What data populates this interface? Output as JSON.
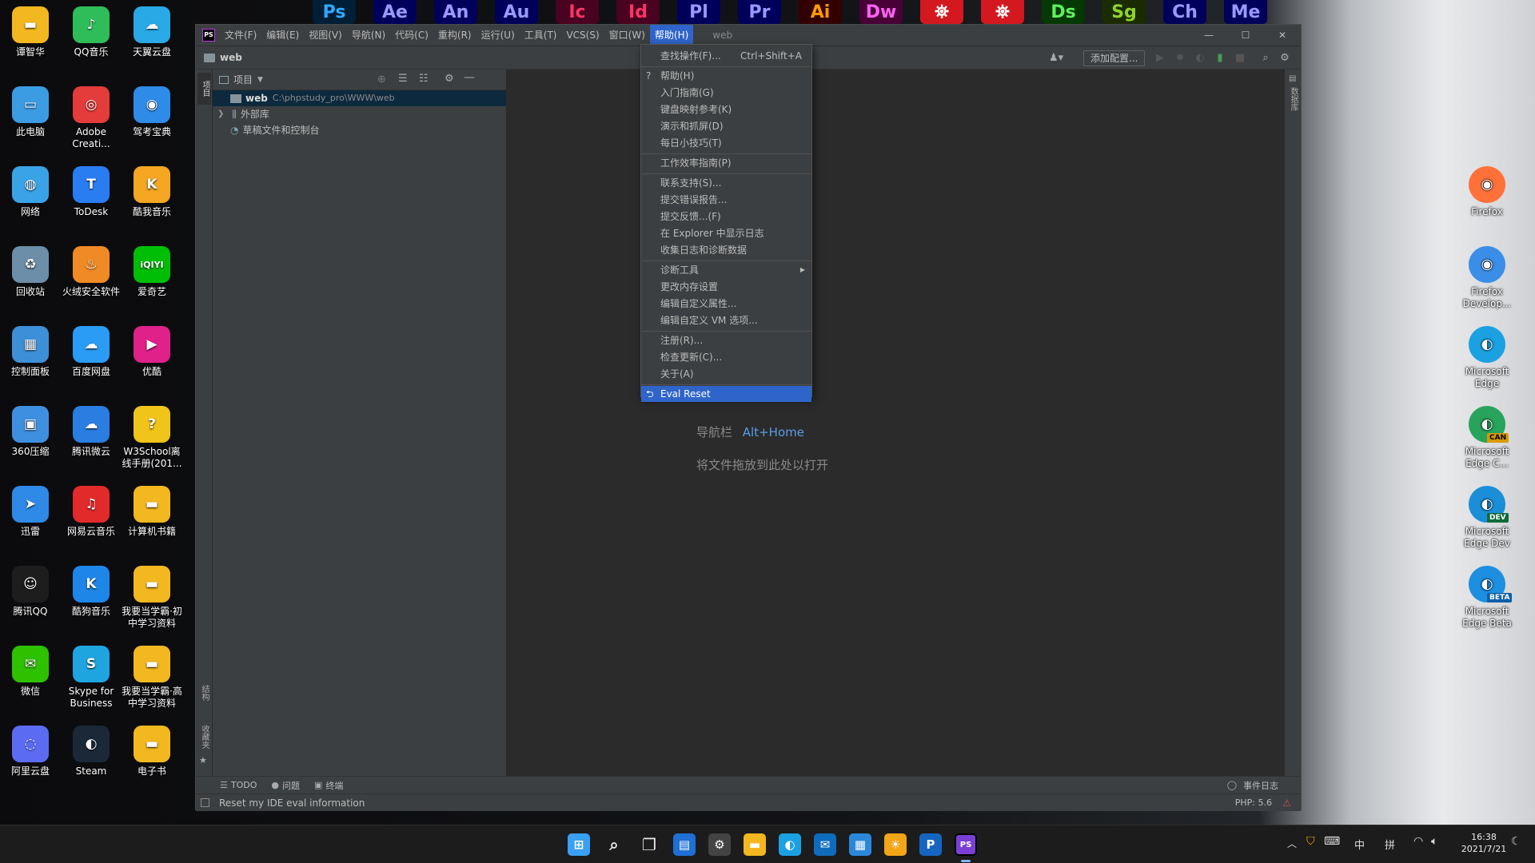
{
  "desktop": {
    "left_icons": [
      {
        "label": "谭智华",
        "glyph": "▬",
        "color": "#f3b81f"
      },
      {
        "label": "QQ音乐",
        "glyph": "♪",
        "color": "#2ebd59"
      },
      {
        "label": "天翼云盘",
        "glyph": "☁",
        "color": "#29a9e6"
      },
      {
        "label": "此电脑",
        "glyph": "▭",
        "color": "#3b9ce4"
      },
      {
        "label": "Adobe Creati...",
        "glyph": "◎",
        "color": "#e43b3b"
      },
      {
        "label": "驾考宝典",
        "glyph": "◉",
        "color": "#2f8be8"
      },
      {
        "label": "网络",
        "glyph": "◍",
        "color": "#3aa3e8"
      },
      {
        "label": "ToDesk",
        "glyph": "T",
        "color": "#2a7df0"
      },
      {
        "label": "酷我音乐",
        "glyph": "K",
        "color": "#f5a623"
      },
      {
        "label": "回收站",
        "glyph": "♻",
        "color": "#6c8ea8"
      },
      {
        "label": "火绒安全软件",
        "glyph": "♨",
        "color": "#f08a24"
      },
      {
        "label": "爱奇艺",
        "glyph": "iQIYI",
        "color": "#00be06"
      },
      {
        "label": "控制面板",
        "glyph": "▦",
        "color": "#3d8fd8"
      },
      {
        "label": "百度网盘",
        "glyph": "☁",
        "color": "#2b9cf5"
      },
      {
        "label": "优酷",
        "glyph": "▶",
        "color": "#e0218a"
      },
      {
        "label": "360压缩",
        "glyph": "▣",
        "color": "#3f8fe0"
      },
      {
        "label": "腾讯微云",
        "glyph": "☁",
        "color": "#2a7de1"
      },
      {
        "label": "W3School离线手册(201...",
        "glyph": "?",
        "color": "#f0c419"
      },
      {
        "label": "迅雷",
        "glyph": "➤",
        "color": "#2e8ae6"
      },
      {
        "label": "网易云音乐",
        "glyph": "♫",
        "color": "#e32a2a"
      },
      {
        "label": "计算机书籍",
        "glyph": "▬",
        "color": "#f3b81f"
      },
      {
        "label": "腾讯QQ",
        "glyph": "☺",
        "color": "#1d1d1d"
      },
      {
        "label": "酷狗音乐",
        "glyph": "K",
        "color": "#1f86e9"
      },
      {
        "label": "我要当学霸·初中学习资料",
        "glyph": "▬",
        "color": "#f3b81f"
      },
      {
        "label": "微信",
        "glyph": "✉",
        "color": "#2dc100"
      },
      {
        "label": "Skype for Business",
        "glyph": "S",
        "color": "#1ea5e0"
      },
      {
        "label": "我要当学霸·高中学习资料",
        "glyph": "▬",
        "color": "#f3b81f"
      },
      {
        "label": "阿里云盘",
        "glyph": "◌",
        "color": "#5b6cf2"
      },
      {
        "label": "Steam",
        "glyph": "◐",
        "color": "#1b2838"
      },
      {
        "label": "电子书",
        "glyph": "▬",
        "color": "#f3b81f"
      }
    ],
    "right_icons": [
      {
        "label": "Firefox",
        "glyph": "◉",
        "color": "#ff7139"
      },
      {
        "label": "Firefox Develop...",
        "glyph": "◉",
        "color": "#3a8ee8"
      },
      {
        "label": "Microsoft Edge",
        "glyph": "◐",
        "color": "#1ba1e2"
      },
      {
        "label": "Microsoft Edge C...",
        "glyph": "◐",
        "color": "#27a35b",
        "badge": "CAN"
      },
      {
        "label": "Microsoft Edge Dev",
        "glyph": "◐",
        "color": "#1b8ed8",
        "badge": "DEV"
      },
      {
        "label": "Microsoft Edge Beta",
        "glyph": "◐",
        "color": "#1d8fe0",
        "badge": "BETA"
      }
    ]
  },
  "dock": [
    {
      "label": "Ps",
      "bg": "#001e36",
      "fg": "#31a8ff"
    },
    {
      "label": "Ae",
      "bg": "#00005b",
      "fg": "#9999ff"
    },
    {
      "label": "An",
      "bg": "#00005b",
      "fg": "#9a9aff"
    },
    {
      "label": "Au",
      "bg": "#00005b",
      "fg": "#9999ff"
    },
    {
      "label": "Ic",
      "bg": "#49021f",
      "fg": "#ff3366"
    },
    {
      "label": "Id",
      "bg": "#49021f",
      "fg": "#ff3366"
    },
    {
      "label": "Pl",
      "bg": "#00005b",
      "fg": "#9999ff"
    },
    {
      "label": "Pr",
      "bg": "#00005b",
      "fg": "#9999ff"
    },
    {
      "label": "Ai",
      "bg": "#330000",
      "fg": "#ff9a00"
    },
    {
      "label": "Dw",
      "bg": "#470137",
      "fg": "#ff61f6"
    },
    {
      "label": "⛯",
      "bg": "#d4181f",
      "fg": "#ffffff"
    },
    {
      "label": "⛯",
      "bg": "#d4181f",
      "fg": "#ffffff"
    },
    {
      "label": "Ds",
      "bg": "#063803",
      "fg": "#5ef05a"
    },
    {
      "label": "Sg",
      "bg": "#1b2b00",
      "fg": "#8fd32d"
    },
    {
      "label": "Ch",
      "bg": "#00005b",
      "fg": "#9999ff"
    },
    {
      "label": "Me",
      "bg": "#00005b",
      "fg": "#9999ff"
    }
  ],
  "ide": {
    "logo": "PS",
    "menu": [
      "文件(F)",
      "编辑(E)",
      "视图(V)",
      "导航(N)",
      "代码(C)",
      "重构(R)",
      "运行(U)",
      "工具(T)",
      "VCS(S)",
      "窗口(W)",
      "帮助(H)"
    ],
    "window_title": "web",
    "breadcrumb": "web",
    "add_config": "添加配置...",
    "left_strip_top": "项目",
    "left_strip_bottom1": "结构",
    "left_strip_bottom2": "收藏夹",
    "right_strip": "数据库",
    "project_header": "项目",
    "tree": [
      {
        "name": "web",
        "path": "C:\\phpstudy_pro\\WWW\\web"
      },
      {
        "name": "外部库",
        "path": ""
      },
      {
        "name": "草稿文件和控制台",
        "path": ""
      }
    ],
    "editor_hint_label": "导航栏",
    "editor_hint_shortcut": "Alt+Home",
    "editor_drop_hint": "将文件拖放到此处以打开",
    "bottom_tabs": [
      "TODO",
      "问题",
      "终端"
    ],
    "event_log": "事件日志",
    "status_text": "Reset my IDE eval information",
    "php_version": "PHP: 5.6"
  },
  "help_menu": [
    {
      "label": "查找操作(F)...",
      "shortcut": "Ctrl+Shift+A"
    },
    {
      "sep": true
    },
    {
      "label": "帮助(H)",
      "icon": "?"
    },
    {
      "label": "入门指南(G)"
    },
    {
      "label": "键盘映射参考(K)"
    },
    {
      "label": "演示和抓屏(D)"
    },
    {
      "label": "每日小技巧(T)"
    },
    {
      "sep": true
    },
    {
      "label": "工作效率指南(P)"
    },
    {
      "sep": true
    },
    {
      "label": "联系支持(S)..."
    },
    {
      "label": "提交错误报告..."
    },
    {
      "label": "提交反馈...(F)"
    },
    {
      "label": "在 Explorer 中显示日志"
    },
    {
      "label": "收集日志和诊断数据"
    },
    {
      "sep": true
    },
    {
      "label": "诊断工具",
      "submenu": true
    },
    {
      "label": "更改内存设置"
    },
    {
      "label": "编辑自定义属性..."
    },
    {
      "label": "编辑自定义 VM 选项..."
    },
    {
      "sep": true
    },
    {
      "label": "注册(R)..."
    },
    {
      "label": "检查更新(C)..."
    },
    {
      "label": "关于(A)"
    },
    {
      "sep": true
    },
    {
      "label": "Eval Reset",
      "icon": "⮌",
      "highlight": true
    }
  ],
  "taskbar": {
    "apps": [
      {
        "name": "start",
        "glyph": "⊞",
        "color": "#3aa0f3"
      },
      {
        "name": "search",
        "glyph": "⌕",
        "color": "transparent"
      },
      {
        "name": "task-view",
        "glyph": "❐",
        "color": "transparent"
      },
      {
        "name": "widgets",
        "glyph": "▤",
        "color": "#1f6fd6"
      },
      {
        "name": "settings",
        "glyph": "⚙",
        "color": "#444"
      },
      {
        "name": "file-explorer",
        "glyph": "▬",
        "color": "#f3b81f"
      },
      {
        "name": "edge",
        "glyph": "◐",
        "color": "#1ba1e2"
      },
      {
        "name": "mail",
        "glyph": "✉",
        "color": "#0f6cbd"
      },
      {
        "name": "store",
        "glyph": "▦",
        "color": "#2b88d8"
      },
      {
        "name": "weather",
        "glyph": "☀",
        "color": "#f2a518"
      },
      {
        "name": "p-app",
        "glyph": "P",
        "color": "#1565c0"
      },
      {
        "name": "phpstorm",
        "glyph": "PS",
        "color": "#7b3fd6"
      }
    ],
    "tray": {
      "ime_lang": "中",
      "ime_mode": "拼",
      "time": "16:38",
      "date": "2021/7/21"
    }
  }
}
